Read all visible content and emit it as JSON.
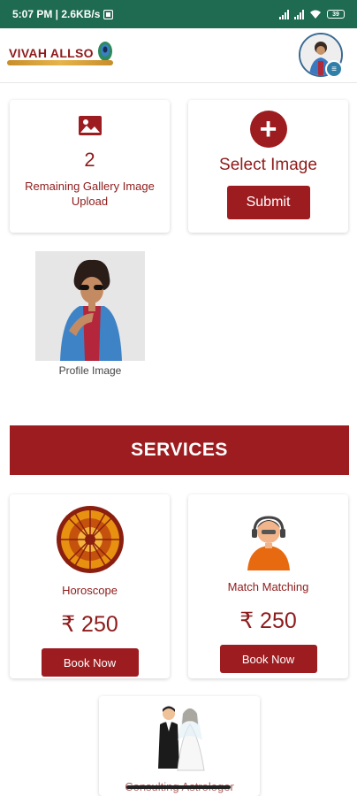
{
  "status_bar": {
    "time_speed": "5:07 PM | 2.6KB/s",
    "battery": "39"
  },
  "header": {
    "logo_text": "VIVAH ALLSO"
  },
  "gallery": {
    "count": "2",
    "remaining_label": "Remaining Gallery Image Upload"
  },
  "select_image": {
    "label": "Select Image",
    "submit_label": "Submit"
  },
  "profile": {
    "caption": "Profile Image"
  },
  "services": {
    "heading": "SERVICES",
    "items": [
      {
        "name": "Horoscope",
        "price": "₹ 250",
        "button": "Book Now",
        "icon": "zodiac-wheel-icon"
      },
      {
        "name": "Match Matching",
        "price": "₹ 250",
        "button": "Book Now",
        "icon": "astrologer-headset-icon"
      },
      {
        "name": "Consulting Astrologer",
        "icon": "bride-groom-icon"
      }
    ]
  },
  "colors": {
    "status_bar": "#1e6b52",
    "brand": "#9d1c20",
    "text_accent": "#8e1b1b"
  }
}
